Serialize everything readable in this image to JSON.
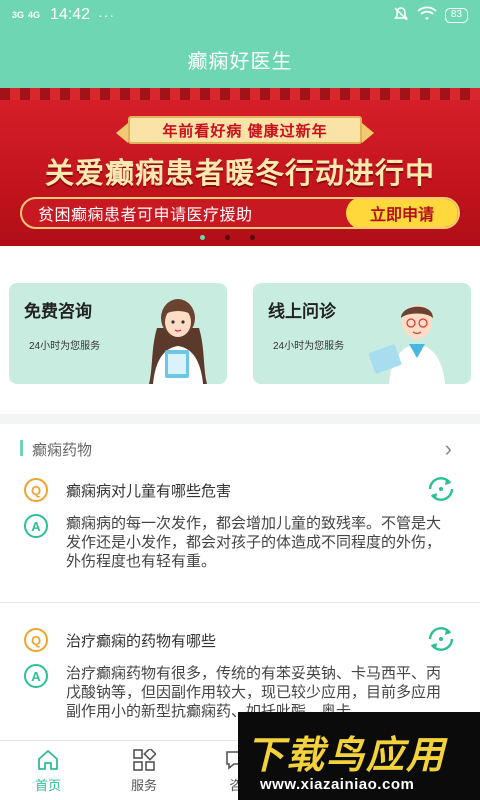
{
  "status": {
    "signal1": "3G",
    "signal2": "4G",
    "time": "14:42",
    "dots": "···",
    "battery": "83"
  },
  "app": {
    "title": "癫痫好医生"
  },
  "banner": {
    "ribbon": "年前看好病  健康过新年",
    "headline": "关爱癫痫患者暖冬行动进行中",
    "subtitle": "贫困癫痫患者可申请医疗援助",
    "button": "立即申请",
    "pages": 3,
    "current_page": 1
  },
  "services": [
    {
      "title": "免费咨询",
      "subtitle": "24小时为您服务"
    },
    {
      "title": "线上问诊",
      "subtitle": "24小时为您服务"
    }
  ],
  "qa": {
    "section_title": "癫痫药物",
    "items": [
      {
        "q_badge": "Q",
        "question": "癫痫病对儿童有哪些危害",
        "a_badge": "A",
        "answer": "癫痫病的每一次发作，都会增加儿童的致残率。不管是大发作还是小发作，都会对孩子的体造成不同程度的外伤，外伤程度也有轻有重。"
      },
      {
        "q_badge": "Q",
        "question": "治疗癫痫的药物有哪些",
        "a_badge": "A",
        "answer": "治疗癫痫药物有很多，传统的有苯妥英钠、卡马西平、丙戊酸钠等，但因副作用较大，现已较少应用，目前多应用副作用小的新型抗癫痫药、如托吡酯、奥卡"
      }
    ]
  },
  "nav": [
    {
      "label": "首页",
      "icon": "home-icon",
      "active": true
    },
    {
      "label": "服务",
      "icon": "grid-icon",
      "active": false
    },
    {
      "label": "咨",
      "icon": "chat-icon",
      "active": false
    }
  ],
  "watermark": {
    "title": "下载鸟应用",
    "url": "www.xiazainiao.com"
  },
  "colors": {
    "accent": "#6fd6b3",
    "answer": "#2bbf96",
    "question": "#f0a42d",
    "banner_red": "#c3141d"
  }
}
